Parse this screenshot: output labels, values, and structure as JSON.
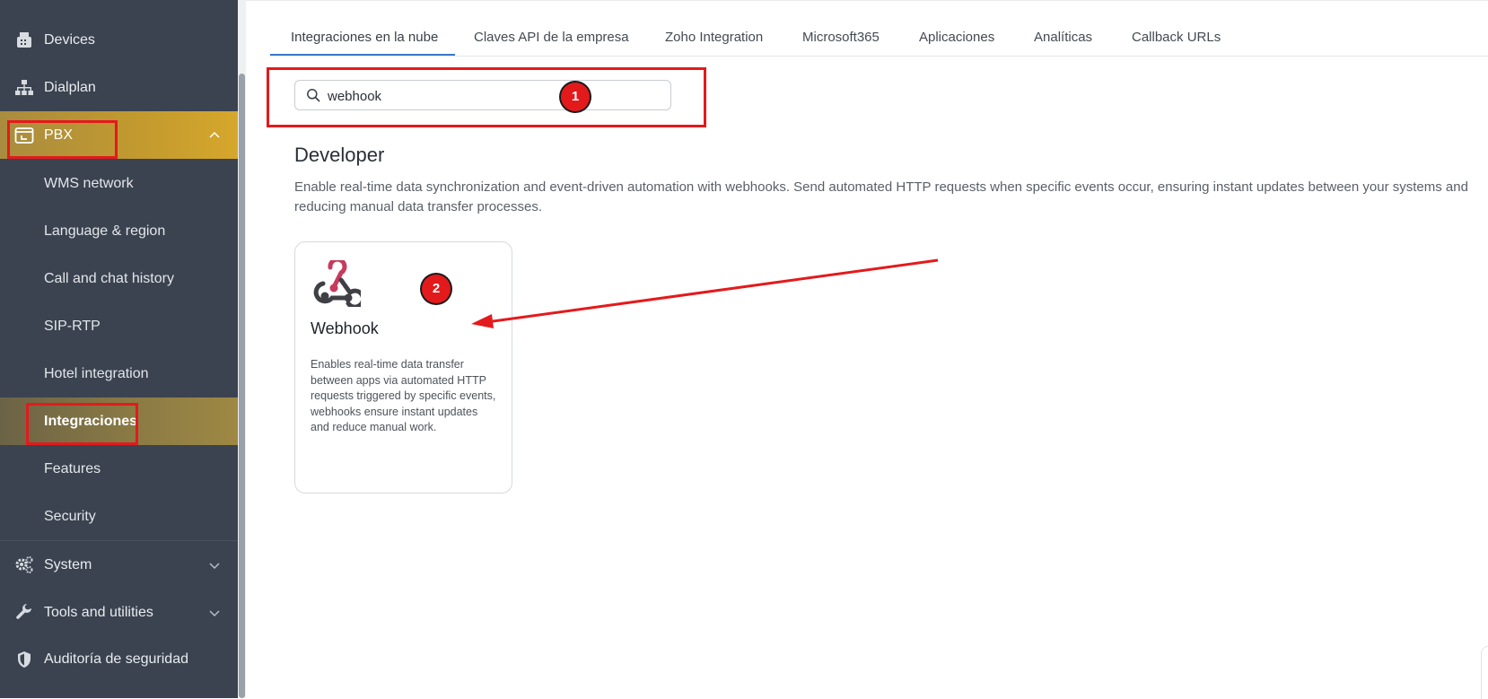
{
  "sidebar": {
    "items": [
      {
        "label": "Devices",
        "icon": "fax-icon"
      },
      {
        "label": "Dialplan",
        "icon": "sitemap-icon"
      },
      {
        "label": "PBX",
        "icon": "pbx-window-icon"
      }
    ],
    "pbx_children": [
      {
        "label": "WMS network"
      },
      {
        "label": "Language & region"
      },
      {
        "label": "Call and chat history"
      },
      {
        "label": "SIP-RTP"
      },
      {
        "label": "Hotel integration"
      },
      {
        "label": "Integraciones"
      },
      {
        "label": "Features"
      },
      {
        "label": "Security"
      }
    ],
    "bottom_items": [
      {
        "label": "System",
        "icon": "gears-icon"
      },
      {
        "label": "Tools and utilities",
        "icon": "wrench-icon"
      },
      {
        "label": "Auditoría de seguridad",
        "icon": "shield-icon"
      }
    ],
    "active_color": "#c39a2e"
  },
  "tabs": [
    {
      "label": "Integraciones en la nube"
    },
    {
      "label": "Claves API de la empresa"
    },
    {
      "label": "Zoho Integration"
    },
    {
      "label": "Microsoft365"
    },
    {
      "label": "Aplicaciones"
    },
    {
      "label": "Analíticas"
    },
    {
      "label": "Callback URLs"
    }
  ],
  "search": {
    "value": "webhook",
    "icon": "search-icon"
  },
  "section": {
    "title": "Developer",
    "description": "Enable real-time data synchronization and event-driven automation with webhooks. Send automated HTTP requests when specific events occur, ensuring instant updates between your systems and reducing manual data transfer processes."
  },
  "card": {
    "icon": "webhook-icon",
    "title": "Webhook",
    "description": "Enables real-time data transfer between apps via automated HTTP requests triggered by specific events, webhooks ensure instant updates and reduce manual work."
  },
  "annotations": {
    "badge1": "1",
    "badge2": "2",
    "color": "#e31a1c"
  }
}
